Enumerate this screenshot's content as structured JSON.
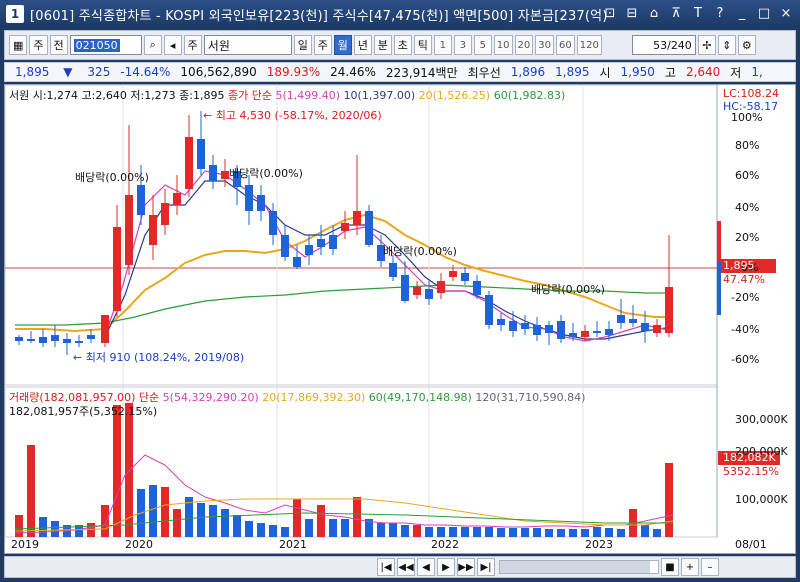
{
  "window": {
    "number": "1",
    "title": "[0601] 주식종합차트 - KOSPI 외국인보유[223(천)] 주식수[47,475(천)] 액면[500] 자본금[237(억)",
    "controls": [
      "⊡",
      "⊟",
      "⌂",
      "⊼",
      "T",
      "?",
      "_",
      "□",
      "×"
    ]
  },
  "toolbar": {
    "market": "주",
    "prev_label": "전",
    "stock_code": "021050",
    "stock_name_prefix": "주",
    "stock_name": "서원",
    "periods": [
      "일",
      "주",
      "월",
      "년",
      "분",
      "초",
      "틱"
    ],
    "active_period": "월",
    "intervals": [
      "1",
      "3",
      "5",
      "10",
      "20",
      "30",
      "60",
      "120"
    ],
    "count": "53/240"
  },
  "quote": {
    "price": "1,895",
    "direction": "▼",
    "change": "325",
    "change_pct": "-14.64%",
    "volume": "106,562,890",
    "vol_ratio": "189.93%",
    "turnover": "24.46%",
    "amount": "223,914백만",
    "pref_label": "최우선",
    "bid": "1,896",
    "ask": "1,895",
    "open_label": "시",
    "open": "1,950",
    "high_label": "고",
    "high": "2,640",
    "low_label": "저",
    "low": "1,"
  },
  "price_legend": {
    "info": "서원 시:1,274 고:2,640 저:1,273 종:1,895",
    "ma_title": "종가 단순",
    "ma5": "5(1,499.40)",
    "ma10": "10(1,397.00)",
    "ma20": "20(1,526.25)",
    "ma60": "60(1,982.83)",
    "lc": "LC:108.24",
    "hc": "HC:-58.17"
  },
  "annotations": {
    "high_note": "최고 4,530 (-58.17%, 2020/06)",
    "low_note": "최저 910 (108.24%, 2019/08)",
    "div1": "배당락(0.00%)",
    "div2": "배당락(0.00%)",
    "div3": "배당락(0.00%)",
    "div4": "배당락(0.00%)"
  },
  "right_axis": {
    "labels": [
      "100%",
      "80%",
      "60%",
      "40%",
      "20%",
      "0%",
      "-20%",
      "-40%",
      "-60%"
    ],
    "price_tag": "1,895",
    "pct_tag": "47.47%"
  },
  "volume_legend": {
    "title": "거래량(182,081,957.00)",
    "ma_title": "단순",
    "ma5": "5(54,329,290.20)",
    "ma20": "20(17,869,392.30)",
    "ma60": "60(49,170,148.98)",
    "ma120": "120(31,710,590.84)",
    "sub": "182,081,957주(5,352.15%)",
    "axis": [
      "300,000K",
      "200,000K",
      "100,000K"
    ],
    "tag": "182,082K",
    "tag_pct": "5352.15%"
  },
  "time_axis": [
    "2019",
    "2020",
    "2021",
    "2022",
    "2023"
  ],
  "time_axis_right": "08/01",
  "scroll_buttons": [
    "|◀",
    "◀◀",
    "◀",
    "▶",
    "▶▶",
    "▶|",
    "■",
    "+",
    "–"
  ],
  "colors": {
    "up": "#e02a2a",
    "down": "#1f63d6",
    "ma5": "#d43fb8",
    "ma10": "#2a3a8f",
    "ma20": "#e8a81c",
    "ma60": "#2f9a3a"
  }
}
